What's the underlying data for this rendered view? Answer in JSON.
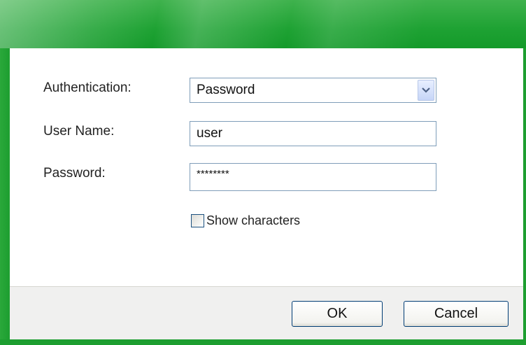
{
  "form": {
    "authentication_label": "Authentication:",
    "authentication_value": "Password",
    "username_label": "User Name:",
    "username_value": "user",
    "password_label": "Password:",
    "password_value": "********",
    "show_characters_label": "Show characters",
    "show_characters_checked": false
  },
  "buttons": {
    "ok_label": "OK",
    "cancel_label": "Cancel"
  },
  "icons": {
    "dropdown": "chevron-down-icon",
    "checkbox": "checkbox-unchecked-icon"
  },
  "colors": {
    "title_bar": "#1ea233",
    "field_border": "#7f9db9",
    "footer_bg": "#f0f0ef"
  }
}
